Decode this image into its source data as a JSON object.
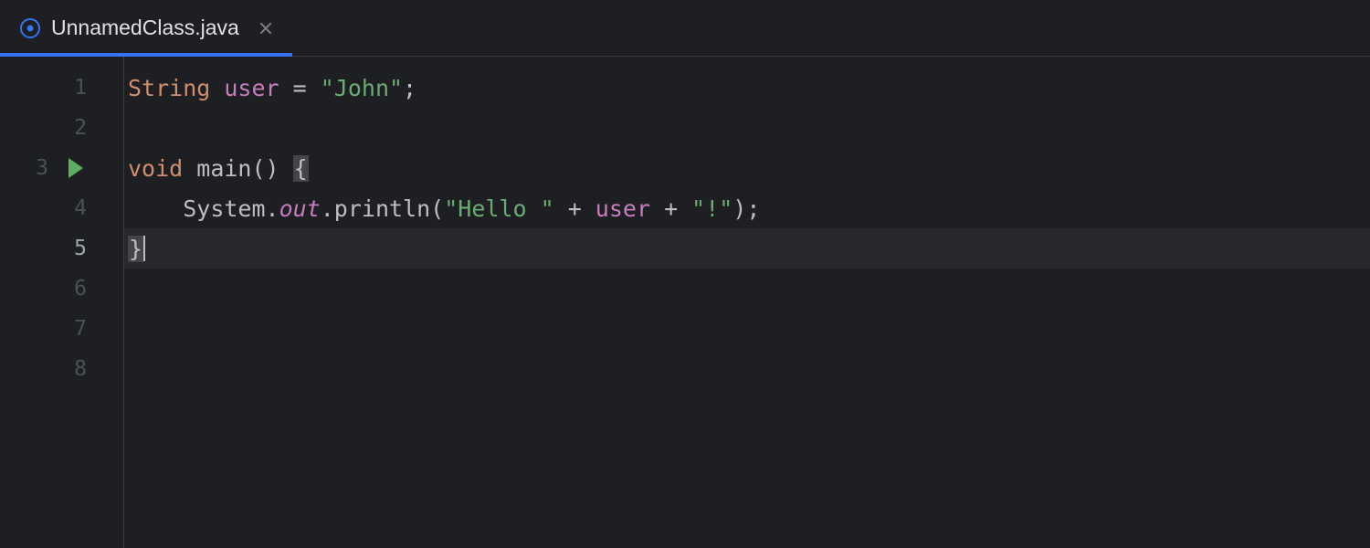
{
  "tab": {
    "filename": "UnnamedClass.java"
  },
  "gutter": {
    "lines": [
      "1",
      "2",
      "3",
      "4",
      "5",
      "6",
      "7",
      "8"
    ],
    "runLine": 3,
    "currentLine": 5
  },
  "code": {
    "line1": {
      "t1": "String ",
      "ident": "user",
      "t2": " = ",
      "str": "\"John\"",
      "t3": ";"
    },
    "line3": {
      "t1": "void ",
      "name": "main",
      "t2": "() ",
      "brace": "{"
    },
    "line4": {
      "indent": "    ",
      "sys": "System.",
      "out": "out",
      "dot": ".",
      "method": "println",
      "open": "(",
      "s1": "\"Hello \"",
      "p1": " + ",
      "var": "user",
      "p2": " + ",
      "s2": "\"!\"",
      "close": ");"
    },
    "line5": {
      "brace": "}"
    }
  }
}
